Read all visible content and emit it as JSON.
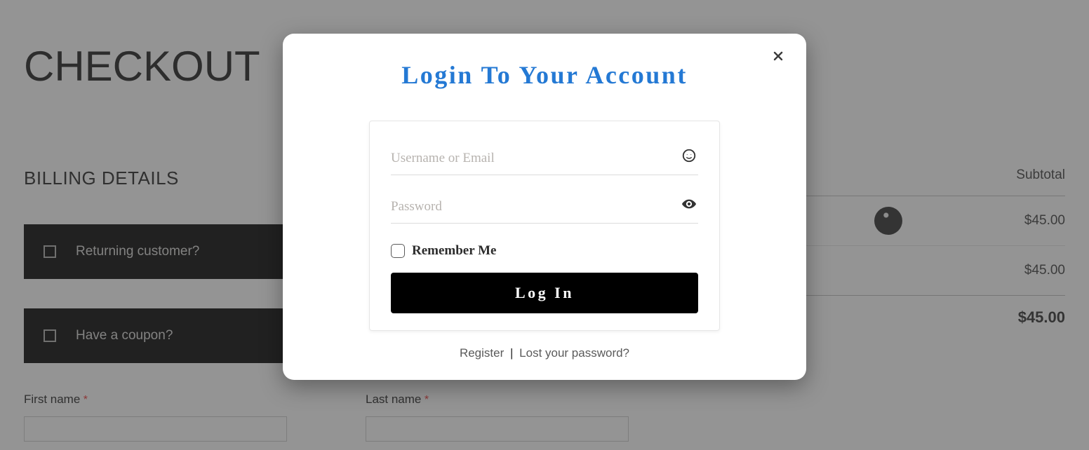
{
  "page": {
    "title": "CHECKOUT",
    "billing_header": "BILLING DETAILS",
    "returning_customer_text": "Returning customer?",
    "have_coupon_text": "Have a coupon?",
    "first_name_label": "First name",
    "last_name_label": "Last name",
    "required_mark": "*"
  },
  "order": {
    "subtotal_header": "Subtotal",
    "line1_price": "$45.00",
    "line2_price": "$45.00",
    "total_price": "$45.00"
  },
  "modal": {
    "title": "Login To Your Account",
    "username_placeholder": "Username or Email",
    "password_placeholder": "Password",
    "remember_label": "Remember Me",
    "login_button": "Log In",
    "register_link": "Register",
    "lost_password_link": "Lost your password?",
    "divider": "|"
  }
}
